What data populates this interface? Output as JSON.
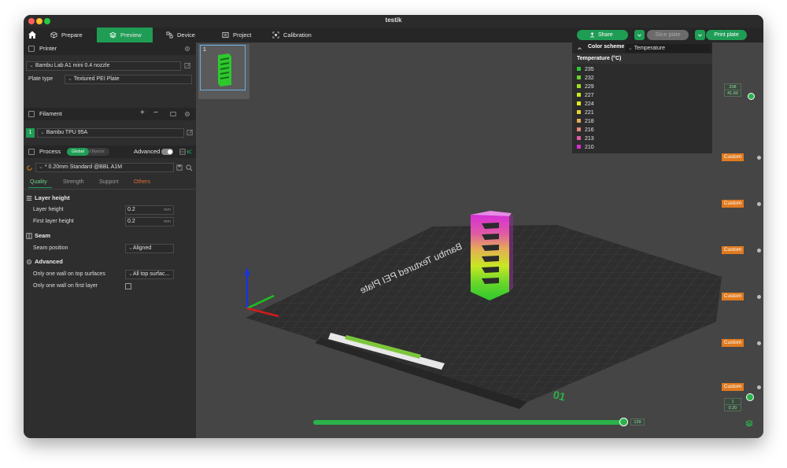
{
  "window": {
    "title": "testik"
  },
  "toolbar": {
    "tabs": [
      {
        "label": "Prepare"
      },
      {
        "label": "Preview"
      },
      {
        "label": "Device"
      },
      {
        "label": "Project"
      },
      {
        "label": "Calibration"
      }
    ],
    "share_label": "Share",
    "slice_label": "Slice plate",
    "print_label": "Print plate"
  },
  "sidebar": {
    "printer": {
      "header": "Printer",
      "printer_name": "Bambu Lab A1 mini 0.4 nozzle",
      "plate_type_label": "Plate type",
      "plate_type_value": "Textured PEI Plate"
    },
    "filament": {
      "header": "Filament",
      "slot_number": "1",
      "filament_name": "Bambu TPU 95A",
      "slot_color": "#1f9d55"
    },
    "process": {
      "header": "Process",
      "toggle_global": "Global",
      "toggle_objects": "Objects",
      "advanced_label": "Advanced",
      "preset_value": "* 0.20mm Standard @BBL A1M",
      "tabs": [
        "Quality",
        "Strength",
        "Support",
        "Others"
      ],
      "groups": {
        "layer_height": {
          "title": "Layer height",
          "layer_height_label": "Layer height",
          "layer_height_value": "0.2",
          "first_layer_label": "First layer height",
          "first_layer_value": "0.2",
          "unit": "mm"
        },
        "seam": {
          "title": "Seam",
          "seam_position_label": "Seam position",
          "seam_position_value": "Aligned"
        },
        "advanced": {
          "title": "Advanced",
          "one_wall_top_label": "Only one wall on top surfaces",
          "one_wall_top_value": "All top surfac...",
          "one_wall_first_label": "Only one wall on first layer"
        }
      }
    }
  },
  "viewport": {
    "plate_thumbnail_number": "1",
    "plate_label": "Bambu Textured PEI Plate",
    "plate_number": "01",
    "color_scheme": {
      "label": "Color scheme",
      "value": "Temperature",
      "legend_title": "Temperature (°C)",
      "entries": [
        {
          "value": "235",
          "color": "#2ec82e"
        },
        {
          "value": "232",
          "color": "#66d62a"
        },
        {
          "value": "229",
          "color": "#9fe026"
        },
        {
          "value": "227",
          "color": "#c8e822"
        },
        {
          "value": "224",
          "color": "#e6ea1e"
        },
        {
          "value": "221",
          "color": "#e8d233"
        },
        {
          "value": "218",
          "color": "#e5ac55"
        },
        {
          "value": "216",
          "color": "#e38778"
        },
        {
          "value": "213",
          "color": "#e05aa4"
        },
        {
          "value": "210",
          "color": "#d72fd6"
        }
      ]
    },
    "layer_slider": {
      "top_layer": "208",
      "top_height": "41.60",
      "bottom_layer": "1",
      "bottom_height": "0.20",
      "custom_labels": [
        "Custom",
        "Custom",
        "Custom",
        "Custom",
        "Custom",
        "Custom"
      ]
    },
    "move_slider_value": "129"
  },
  "colors": {
    "accent": "#1f9d55",
    "custom_tag": "#e07a1f"
  }
}
